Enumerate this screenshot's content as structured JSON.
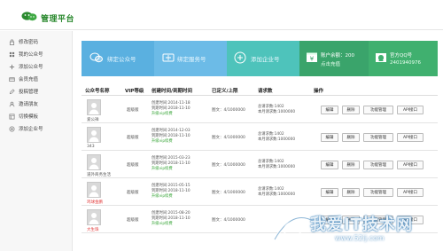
{
  "header": {
    "title": "管理平台"
  },
  "sidebar": {
    "items": [
      {
        "label": "修改密码",
        "icon": "lock-icon"
      },
      {
        "label": "我的公众号",
        "icon": "grid-icon"
      },
      {
        "label": "添加公众号",
        "icon": "plus-icon"
      },
      {
        "label": "会员充值",
        "icon": "card-icon"
      },
      {
        "label": "投稿管理",
        "icon": "edit-icon"
      },
      {
        "label": "邀请朋友",
        "icon": "user-icon"
      },
      {
        "label": "切换模板",
        "icon": "template-icon"
      },
      {
        "label": "添加企业号",
        "icon": "plus-circle-icon"
      }
    ]
  },
  "tiles": {
    "bind_public": "绑定公众号",
    "bind_service": "绑定服务号",
    "add_enterprise": "添加企业号",
    "balance_label": "账户余额：200",
    "recharge": "点击充值",
    "qq_label": "官方QQ号",
    "qq_number": "2401940976"
  },
  "table": {
    "headers": {
      "name": "公众号名称",
      "vip": "VIP等级",
      "dates": "创建时间/到期时间",
      "fans": "已定义/上限",
      "requests": "请求数",
      "actions": "操作"
    },
    "buttons": {
      "edit": "编辑",
      "delete": "删除",
      "func": "功能管理",
      "api": "API接口"
    },
    "rows": [
      {
        "name": "爱公祥",
        "vip": "超级版",
        "created": "创建时间:2014-11-18",
        "expires": "到期时间:2018-11-10",
        "upgrade": "升级vip续费",
        "fans": "图文：4/1000000",
        "total_req": "总请求数:1402",
        "month_req": "本月请求数:1000000",
        "name_red": false
      },
      {
        "name": "343",
        "vip": "超级版",
        "created": "创建时间:2014-12-03",
        "expires": "到期时间:2018-11-10",
        "upgrade": "升级vip续费",
        "fans": "图文：4/1000000",
        "total_req": "总请求数:1402",
        "month_req": "本月请求数:1000000",
        "name_red": false
      },
      {
        "name": "道外商务生活",
        "vip": "超级版",
        "created": "创建时间:2015-03-23",
        "expires": "到期时间:2018-11-10",
        "upgrade": "升级vip续费",
        "fans": "图文：4/1000000",
        "total_req": "总请求数:1402",
        "month_req": "本月请求数:1000000",
        "name_red": false
      },
      {
        "name": "鸡球金鹏",
        "vip": "超级版",
        "created": "创建时间:2015-05-15",
        "expires": "到期时间:2018-11-10",
        "upgrade": "升级vip续费",
        "fans": "图文：4/1000000",
        "total_req": "总请求数:1402",
        "month_req": "本月请求数:1000000",
        "name_red": true
      },
      {
        "name": "大生珠",
        "vip": "超级版",
        "created": "创建时间:2015-08-20",
        "expires": "到期时间:2018-11-10",
        "upgrade": "升级vip续费",
        "fans": "图文：4/1000000",
        "total_req": "",
        "month_req": "",
        "name_red": true
      }
    ]
  },
  "watermark": {
    "main": "我爱IT技术网",
    "sub": "www.52ij.com"
  },
  "colors": {
    "brand_green": "#2c8a30",
    "tile_blue": "#5ab0e0",
    "tile_teal": "#4ec3bb",
    "tile_green": "#3aa46b",
    "upgrade_green": "#3aa63a",
    "name_red": "#e23b3b"
  }
}
